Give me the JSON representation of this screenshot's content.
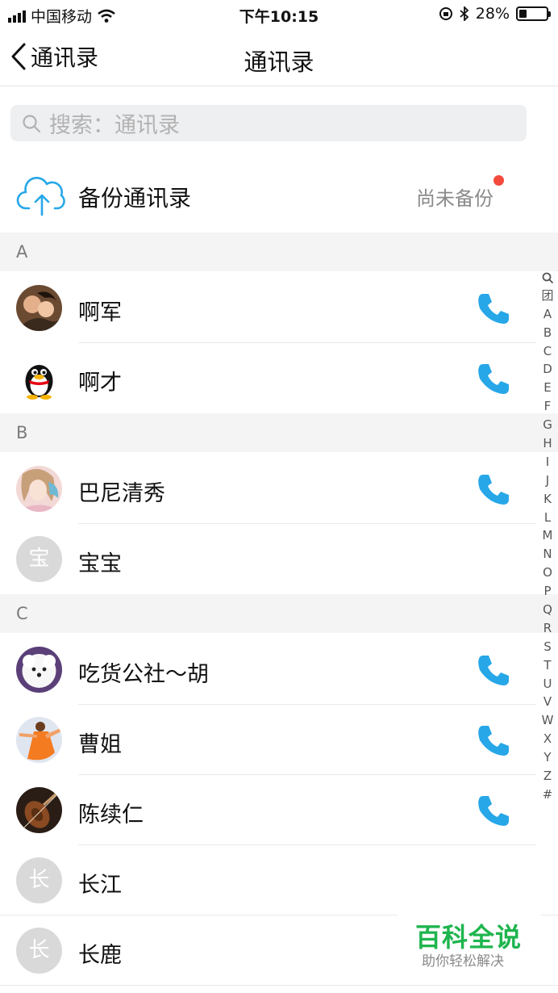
{
  "status_bar": {
    "carrier": "中国移动",
    "time": "下午10:15",
    "battery": "28%",
    "battery_level": 0.28
  },
  "nav": {
    "back_label": "通讯录",
    "title": "通讯录"
  },
  "search": {
    "placeholder": "搜索：通讯录"
  },
  "backup": {
    "label": "备份通讯录",
    "status": "尚未备份"
  },
  "sections": [
    {
      "letter": "A",
      "contacts": [
        {
          "name": "啊军",
          "avatar": "photo-couple",
          "has_phone": true
        },
        {
          "name": "啊才",
          "avatar": "qq-penguin",
          "has_phone": true
        }
      ]
    },
    {
      "letter": "B",
      "contacts": [
        {
          "name": "巴尼清秀",
          "avatar": "photo-girl",
          "has_phone": true
        },
        {
          "name": "宝宝",
          "avatar_letter": "宝",
          "has_phone": false
        }
      ]
    },
    {
      "letter": "C",
      "contacts": [
        {
          "name": "吃货公社～胡",
          "avatar": "photo-dog",
          "has_phone": true
        },
        {
          "name": "曹姐",
          "avatar": "photo-dancer",
          "has_phone": true
        },
        {
          "name": "陈续仁",
          "avatar": "photo-violin",
          "has_phone": true
        },
        {
          "name": "长江",
          "avatar_letter": "长",
          "has_phone": false
        },
        {
          "name": "长鹿",
          "avatar_letter": "长",
          "has_phone": false
        }
      ]
    }
  ],
  "index_bar": [
    "search-icon",
    "团",
    "A",
    "B",
    "C",
    "D",
    "E",
    "F",
    "G",
    "H",
    "I",
    "J",
    "K",
    "L",
    "M",
    "N",
    "O",
    "P",
    "Q",
    "R",
    "S",
    "T",
    "U",
    "V",
    "W",
    "X",
    "Y",
    "Z",
    "#"
  ],
  "watermark": {
    "title": "百科全说",
    "subtitle": "助你轻松解决"
  },
  "colors": {
    "accent": "#27a7e8",
    "badge": "#f24a3d",
    "watermark": "#1fb54e"
  }
}
